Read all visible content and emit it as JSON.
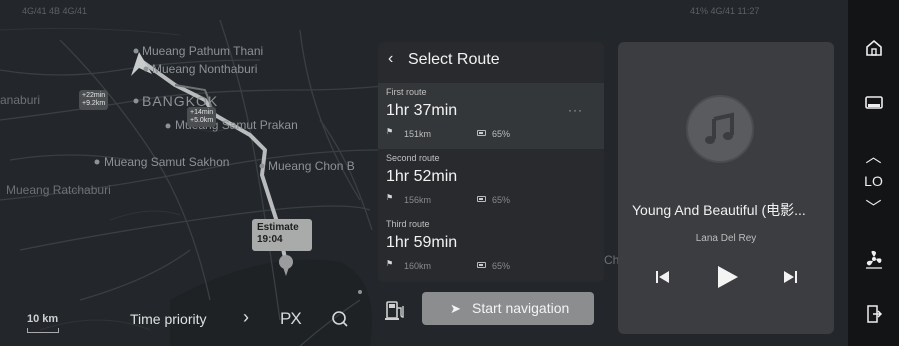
{
  "map": {
    "cities": [
      {
        "name": "Mueang Pathum Thani"
      },
      {
        "name": "Mueang Nonthaburi"
      },
      {
        "name": "BANGKOK"
      },
      {
        "name": "Mueang Samut Prakan"
      },
      {
        "name": "Mueang Samut Sakhon"
      },
      {
        "name": "Mueang Chon B"
      },
      {
        "name": "Mueang Ratchaburi"
      },
      {
        "name": "anaburi"
      },
      {
        "name": "Ch"
      }
    ],
    "alt_bubble_1": {
      "line1": "+22min",
      "line2": "+9.2km"
    },
    "alt_bubble_2": {
      "line1": "+14min",
      "line2": "+5.0km"
    },
    "estimate": {
      "label": "Estimate",
      "time": "19:04"
    },
    "scale": "10 km",
    "status_left": "4G/41 4B 4G/41",
    "status_right": "41% 4G/41 11:27"
  },
  "bottom_bar": {
    "time_priority": "Time priority",
    "chevron": "›",
    "px_icon": "PX",
    "search_icon": "search-icon"
  },
  "route_panel": {
    "back": "‹",
    "title": "Select Route",
    "routes": [
      {
        "label": "First route",
        "time": "1hr 37min",
        "distance": "151km",
        "battery": "65%",
        "selected": true
      },
      {
        "label": "Second route",
        "time": "1hr 52min",
        "distance": "156km",
        "battery": "65%",
        "selected": false
      },
      {
        "label": "Third route",
        "time": "1hr 59min",
        "distance": "160km",
        "battery": "65%",
        "selected": false
      }
    ],
    "more": "···",
    "start_button": "Start navigation",
    "fuel_icon": "charging-station-icon"
  },
  "media": {
    "song": "Young And Beautiful (电影...",
    "artist": "Lana Del Rey",
    "controls": [
      "previous-icon",
      "play-icon",
      "next-icon"
    ]
  },
  "rail": {
    "home_icon": "home-icon",
    "screen_icon": "display-icon",
    "up": "︿",
    "temp": "LO",
    "down": "﹀",
    "fan_icon": "fan-icon",
    "exit_icon": "exit-icon"
  },
  "colors": {
    "map_bg": "#23272b",
    "panel_bg": "#282a2d",
    "route_line": "#b9bbbc",
    "accent_button": "#8b8d8f"
  }
}
